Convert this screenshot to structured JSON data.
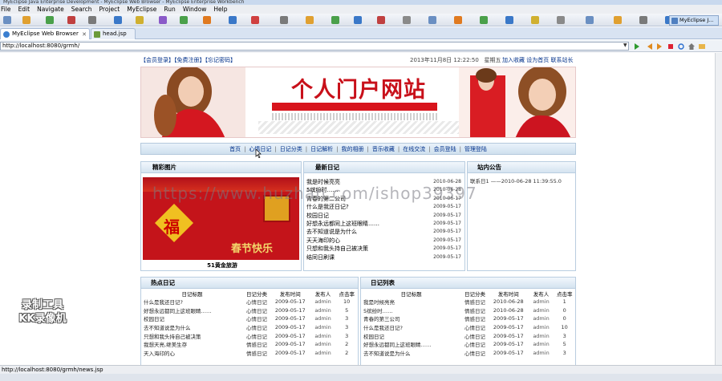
{
  "window": {
    "title": "MyEclipse Java Enterprise Development - MyEclipse Web Browser - MyEclipse Enterprise Workbench"
  },
  "menu": [
    "File",
    "Edit",
    "Navigate",
    "Search",
    "Project",
    "MyEclipse",
    "Run",
    "Window",
    "Help"
  ],
  "perspective": "MyEclipse J...",
  "tabs": [
    {
      "label": "MyEclipse Web Browser",
      "active": true
    },
    {
      "label": "head.jsp",
      "active": false
    }
  ],
  "browser": {
    "url": "http://localhost:8080/grmh/"
  },
  "status": {
    "text": "http://localhost:8080/grmh/news.jsp"
  },
  "site": {
    "topbar": {
      "links": "【会员登录】【免费注册】【忘记密码】",
      "date": "2013年11月8日  12:22:50",
      "weekday": "星期五",
      "right_links": "加入收藏  设为首页  联系站长"
    },
    "banner_title": "个人门户网站",
    "nav": [
      "首页",
      "心情日记",
      "日记分类",
      "日记解析",
      "我的相册",
      "音乐收藏",
      "在线交流",
      "会员登陆",
      "管理登陆"
    ],
    "photos": {
      "title": "精彩图片",
      "image_text_1": "福",
      "image_text_2": "春节快乐",
      "caption": "51黄金旅游"
    },
    "latest": {
      "title": "最新日记",
      "items": [
        {
          "title": "我是时候亮亮",
          "date": "2010-06-28"
        },
        {
          "title": "5缤纷时……",
          "date": "2010-06-28"
        },
        {
          "title": "青春的第二公司",
          "date": "2010-06-17"
        },
        {
          "title": "什么是我还日记?",
          "date": "2009-05-17"
        },
        {
          "title": "校园日记",
          "date": "2009-05-17"
        },
        {
          "title": "好想永远都同上这班眼睛……",
          "date": "2009-05-17"
        },
        {
          "title": "去不知道说是为什么",
          "date": "2009-05-17"
        },
        {
          "title": "天天海印的心",
          "date": "2009-05-17"
        },
        {
          "title": "只想和我头持自己被决策",
          "date": "2009-05-17"
        },
        {
          "title": "结同日刷课",
          "date": "2009-05-17"
        }
      ]
    },
    "notice": {
      "title": "站内公告",
      "text": "联系日1 ——2010-06-28 11:39:55.0"
    },
    "hot": {
      "title": "热点日记",
      "columns": [
        "日记标题",
        "日记分类",
        "发布时间",
        "发布人",
        "点击率"
      ],
      "rows": [
        [
          "什么是我还日记?",
          "心情日记",
          "2009-05-17",
          "admin",
          "10"
        ],
        [
          "好想永远都同上这班眼睛……",
          "心情日记",
          "2009-05-17",
          "admin",
          "5"
        ],
        [
          "校园日记",
          "心情日记",
          "2009-05-17",
          "admin",
          "3"
        ],
        [
          "去不知道说是为什么",
          "心情日记",
          "2009-05-17",
          "admin",
          "3"
        ],
        [
          "只想和我头持自己被决策",
          "心情日记",
          "2009-05-17",
          "admin",
          "3"
        ],
        [
          "我想天亮,继美生存",
          "情感日记",
          "2009-05-17",
          "admin",
          "2"
        ],
        [
          "天入海印的心",
          "情感日记",
          "2009-05-17",
          "admin",
          "2"
        ]
      ]
    },
    "diary_list": {
      "title": "日记列表",
      "columns": [
        "日记标题",
        "日记分类",
        "发布时间",
        "发布人",
        "点击率"
      ],
      "rows": [
        [
          "我是时候亮亮",
          "情感日记",
          "2010-06-28",
          "admin",
          "1"
        ],
        [
          "5缤纷时……",
          "情感日记",
          "2010-06-28",
          "admin",
          "0"
        ],
        [
          "青春的第三公司",
          "情感日记",
          "2009-05-17",
          "admin",
          "0"
        ],
        [
          "什么是我还日记?",
          "心情日记",
          "2009-05-17",
          "admin",
          "10"
        ],
        [
          "校园日记",
          "心情日记",
          "2009-05-17",
          "admin",
          "3"
        ],
        [
          "好想永远都同上这班眼睛……",
          "心情日记",
          "2009-05-17",
          "admin",
          "5"
        ],
        [
          "去不知道说是为什么",
          "心情日记",
          "2009-05-17",
          "admin",
          "3"
        ]
      ]
    }
  },
  "overlay": {
    "watermark": "https://www.huzhan.com/ishop39397",
    "recorder": "录制工具\nKK录像机"
  }
}
